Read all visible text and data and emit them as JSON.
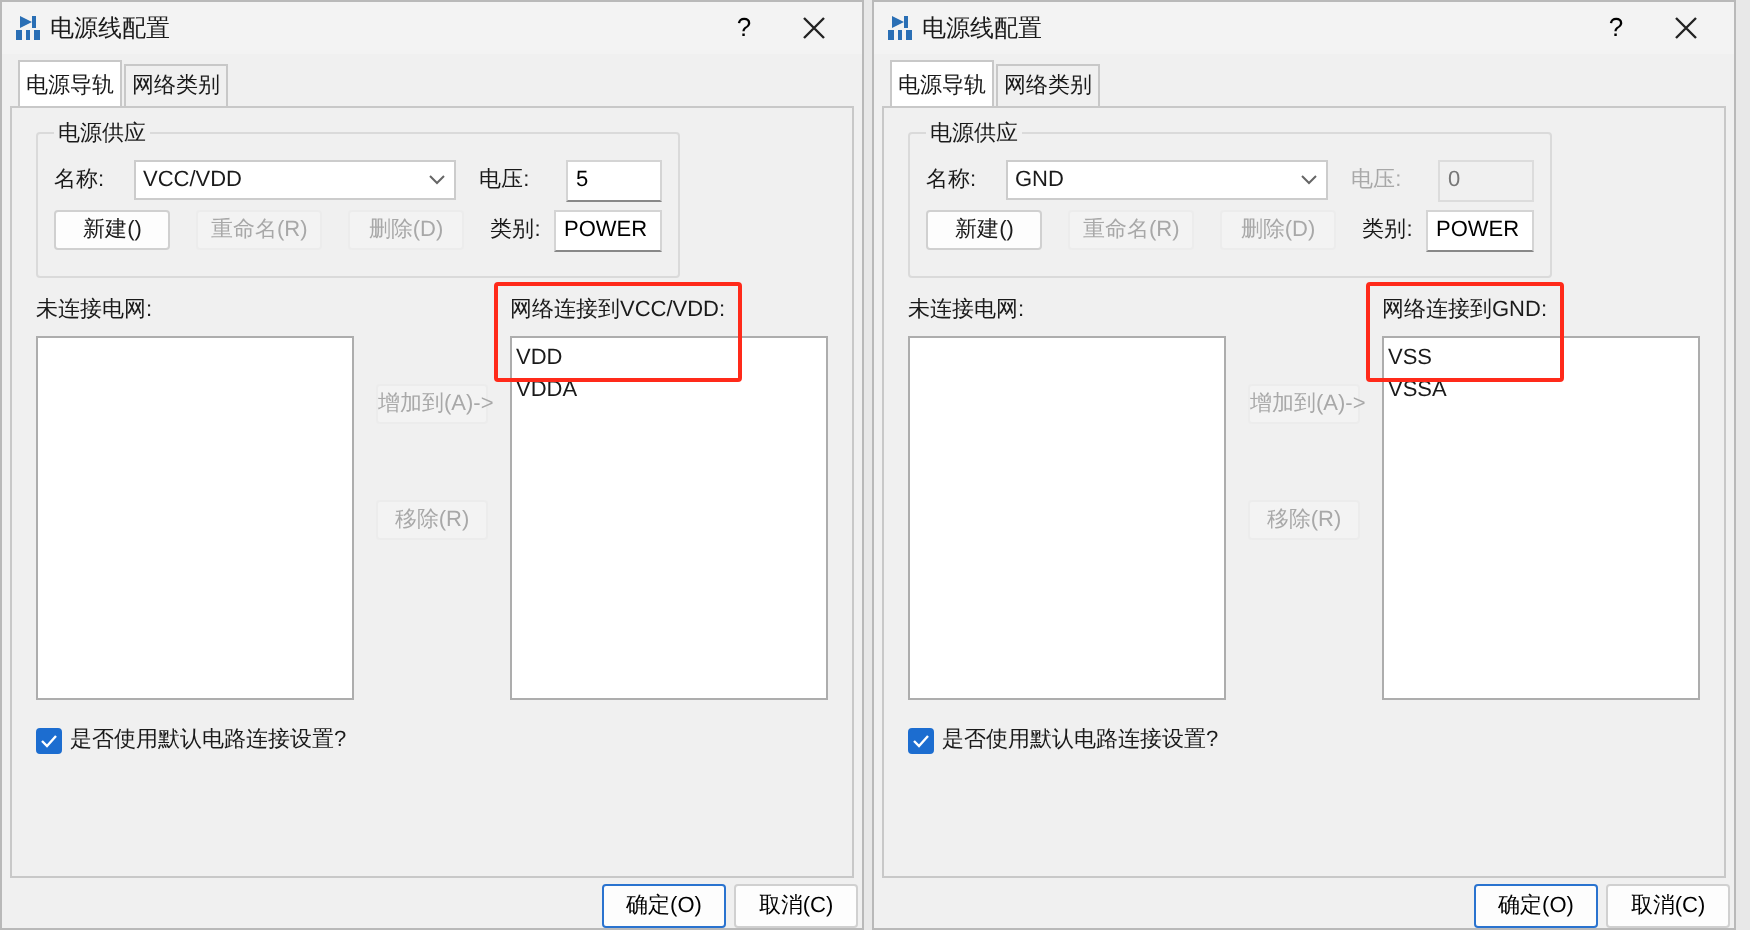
{
  "dialogs": [
    {
      "title": "电源线配置",
      "help": "?",
      "tabs": [
        {
          "label": "电源导轨",
          "selected": true
        },
        {
          "label": "网络类别",
          "selected": false
        }
      ],
      "supply": {
        "title": "电源供应",
        "name_label": "名称:",
        "name_value": "VCC/VDD",
        "voltage_label": "电压:",
        "voltage_value": "5",
        "voltage_disabled": false,
        "category_label": "类别:",
        "category_value": "POWER",
        "buttons": [
          {
            "label": "新建()",
            "disabled": false
          },
          {
            "label": "重命名(R)",
            "disabled": true
          },
          {
            "label": "删除(D)",
            "disabled": true
          }
        ]
      },
      "unconnected_label": "未连接电网:",
      "connected_label": "网络连接到VCC/VDD:",
      "connected_items": [
        "VDD",
        "VDDA"
      ],
      "highlighted": true,
      "move_buttons": [
        {
          "label": "增加到(A)->",
          "disabled": true
        },
        {
          "label": "移除(R)",
          "disabled": true
        }
      ],
      "checkbox": {
        "label": "是否使用默认电路连接设置?",
        "checked": true
      },
      "footer_buttons": [
        {
          "label": "确定(O)",
          "default": true
        },
        {
          "label": "取消(C)",
          "default": false
        }
      ]
    },
    {
      "title": "电源线配置",
      "help": "?",
      "tabs": [
        {
          "label": "电源导轨",
          "selected": true
        },
        {
          "label": "网络类别",
          "selected": false
        }
      ],
      "supply": {
        "title": "电源供应",
        "name_label": "名称:",
        "name_value": "GND",
        "voltage_label": "电压:",
        "voltage_value": "0",
        "voltage_disabled": true,
        "category_label": "类别:",
        "category_value": "POWER",
        "buttons": [
          {
            "label": "新建()",
            "disabled": false
          },
          {
            "label": "重命名(R)",
            "disabled": true
          },
          {
            "label": "删除(D)",
            "disabled": true
          }
        ]
      },
      "unconnected_label": "未连接电网:",
      "connected_label": "网络连接到GND:",
      "connected_items": [
        "VSS",
        "VSSA"
      ],
      "highlighted": true,
      "move_buttons": [
        {
          "label": "增加到(A)->",
          "disabled": true
        },
        {
          "label": "移除(R)",
          "disabled": true
        }
      ],
      "checkbox": {
        "label": "是否使用默认电路连接设置?",
        "checked": true
      },
      "footer_buttons": [
        {
          "label": "确定(O)",
          "default": true
        },
        {
          "label": "取消(C)",
          "default": false
        }
      ]
    }
  ]
}
